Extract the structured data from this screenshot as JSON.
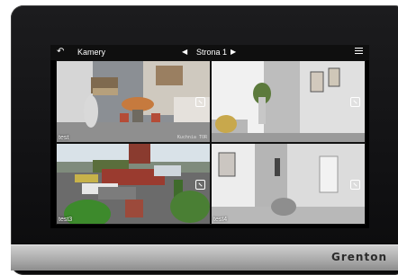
{
  "header": {
    "back_icon": "back-arrow-icon",
    "title": "Kamery",
    "page_label": "Strona 1",
    "prev_icon": "prev-page-icon",
    "next_icon": "next-page-icon",
    "menu_icon": "menu-icon"
  },
  "cameras": [
    {
      "label": "test",
      "stamp": "Kuchnia TOR"
    },
    {
      "label": "",
      "stamp": ""
    },
    {
      "label": "test3",
      "stamp": ""
    },
    {
      "label": "test4",
      "stamp": ""
    }
  ],
  "device": {
    "brand": "Grenton"
  }
}
